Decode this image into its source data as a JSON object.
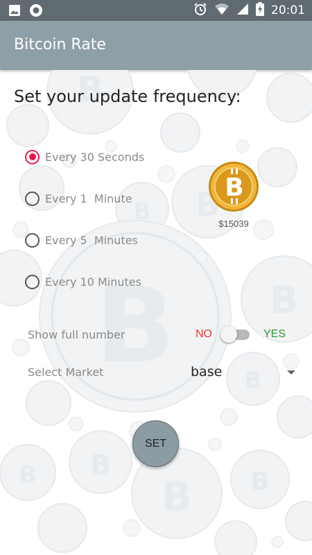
{
  "status_bar": {
    "time": "20:01",
    "icons_left": [
      "image-icon",
      "record-icon"
    ],
    "icons_right": [
      "alarm-icon",
      "wifi-icon",
      "signal-icon",
      "battery-charging-icon"
    ]
  },
  "app_bar": {
    "title": "Bitcoin Rate",
    "color": "#8ea0a7"
  },
  "main": {
    "heading": "Set your update frequency:",
    "frequency_options": [
      {
        "label": "Every 30 Seconds",
        "selected": true
      },
      {
        "label": "Every 1  Minute",
        "selected": false
      },
      {
        "label": "Every 5  Minutes",
        "selected": false
      },
      {
        "label": "Every 10 Minutes",
        "selected": false
      }
    ],
    "price": "$15039",
    "full_number": {
      "label": "Show full number",
      "off_label": "NO",
      "on_label": "YES",
      "enabled": false
    },
    "market": {
      "label": "Select Market",
      "value": "base"
    },
    "set_label": "SET"
  },
  "colors": {
    "accent": "#e8194e",
    "no": "#e53935",
    "yes": "#2e9a3a",
    "button": "#8c9ca3"
  }
}
